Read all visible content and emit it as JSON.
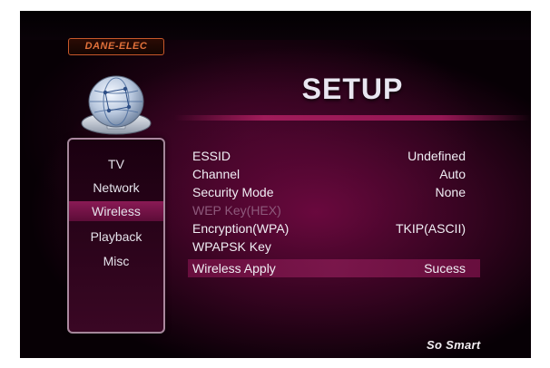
{
  "brand": {
    "logo_text": "DANE-ELEC",
    "tagline": "So Smart"
  },
  "header": {
    "title": "SETUP"
  },
  "menu": {
    "items": [
      {
        "label": "TV"
      },
      {
        "label": "Network"
      },
      {
        "label": "Wireless",
        "selected": true
      },
      {
        "label": "Playback"
      },
      {
        "label": "Misc"
      }
    ]
  },
  "settings": {
    "rows": [
      {
        "label": "ESSID",
        "value": "Undefined"
      },
      {
        "label": "Channel",
        "value": "Auto"
      },
      {
        "label": "Security Mode",
        "value": "None"
      },
      {
        "label": "WEP Key(HEX)",
        "value": "",
        "disabled": true
      },
      {
        "label": "Encryption(WPA)",
        "value": "TKIP(ASCII)"
      },
      {
        "label": "WPAPSK Key",
        "value": ""
      },
      {
        "label": "Wireless Apply",
        "value": "Sucess",
        "highlighted": true
      }
    ]
  },
  "colors": {
    "accent": "#8a1a55",
    "background": "#070005",
    "logo": "#e0703a",
    "disabled_text": "#8e5a7c"
  },
  "icons": {
    "device": "network-globe-icon"
  }
}
